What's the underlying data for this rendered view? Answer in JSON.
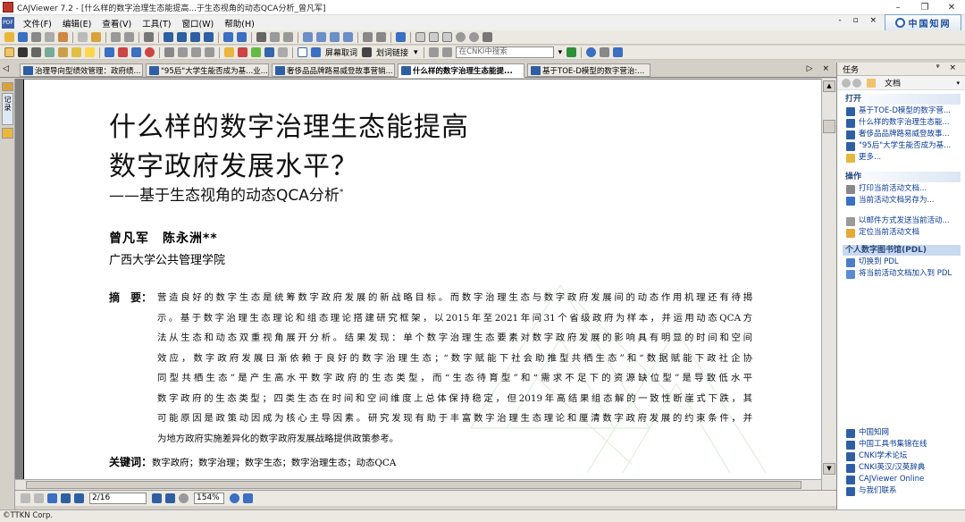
{
  "window": {
    "title": "CAJViewer 7.2 - [什么样的数字治理生态能提高...于生态视角的动态QCA分析_曾凡军]",
    "controls": {
      "minimize": "–",
      "maximize": "❐",
      "close": "✕"
    }
  },
  "menu": {
    "items": [
      "文件(F)",
      "编辑(E)",
      "查看(V)",
      "工具(T)",
      "窗口(W)",
      "帮助(H)"
    ],
    "mdi_controls": "- ▫ ×"
  },
  "logo": {
    "text": "中国知网"
  },
  "toolbar2": {
    "screen_capture": "屏幕取词",
    "hyperlink": "划词链接",
    "search_placeholder": "在CNKI中搜索"
  },
  "tabs": [
    {
      "label": "治理导向型绩效管理：政府绩..."
    },
    {
      "label": "\"95后\"大学生能否成为基...业..."
    },
    {
      "label": "奢侈品品牌路易威登故事营销..."
    },
    {
      "label": "什么样的数字治理生态能提...",
      "active": true
    },
    {
      "label": "基于TOE-D模型的数字营治:..."
    }
  ],
  "tab_nav": {
    "left": "◁",
    "right": "▷ ×"
  },
  "left_strip": {
    "label": "记录"
  },
  "document": {
    "title_line1": "什么样的数字治理生态能提高",
    "title_line2": "数字政府发展水平？",
    "subtitle": "——基于生态视角的动态QCA分析",
    "subtitle_mark": "*",
    "authors": "曾凡军　陈永洲**",
    "affiliation": "广西大学公共管理学院",
    "abstract_label": "摘　要：",
    "abstract_lines": [
      "营造良好的数字生态是统筹数字政府发展的新战略目标。而数字治理生态与数字政府发展间的动态作用机理还有待揭",
      "示。基于数字治理生态理论和组态理论搭建研究框架，以2015年至2021年间31个省级政府为样本，并运用动态QCA方",
      "法从生态和动态双重视角展开分析。结果发现：单个数字治理生态要素对数字政府发展的影响具有明显的时间和空间",
      "效应，数字政府发展日渐依赖于良好的数字治理生态；“数字赋能下社会助推型共栖生态”和“数据赋能下政社企协",
      "同型共栖生态”是产生高水平数字政府的生态类型，而“生态待育型”和“需求不足下的资源缺位型”是导致低水平",
      "数字政府的生态类型；四类生态在时间和空间维度上总体保持稳定，但2019年高结果组态解的一致性断崖式下跌，其",
      "可能原因是政策动因成为核心主导因素。研究发现有助于丰富数字治理生态理论和厘清数字政府发展的约束条件，并",
      "为地方政府实施差异化的数字政府发展战略提供政策参考。"
    ],
    "keywords_label": "关键词：",
    "keywords": "数字政府；数字治理；数字生态；数字治理生态；动态QCA"
  },
  "statusnav": {
    "page": "2/16",
    "zoom": "154%"
  },
  "statusbar": {
    "text": "©TTKN Corp."
  },
  "task_panel": {
    "header": "任务",
    "pin": "ᵠ ×",
    "nav_label": "文档",
    "open_section": "打开",
    "open_items": [
      "基于TOE-D模型的数字营...",
      "什么样的数字治理生态能...",
      "奢侈品品牌路易威登故事...",
      "\"95后\"大学生能否成为基..."
    ],
    "more": "更多...",
    "ops_section": "操作",
    "ops_items": [
      "打印当前活动文档...",
      "当前活动文档另存为..."
    ],
    "ops_items2": [
      "以邮件方式发送当前活动...",
      "定位当前活动文档"
    ],
    "library_section": "个人数字图书馆(PDL)",
    "library_items": [
      "切换到 PDL",
      "将当前活动文档加入到 PDL"
    ],
    "links": [
      "中国知网",
      "中国工具书集锦在线",
      "CNKI学术论坛",
      "CNKI英汉/汉英辞典",
      "CAJViewer Online",
      "与我们联系"
    ]
  }
}
